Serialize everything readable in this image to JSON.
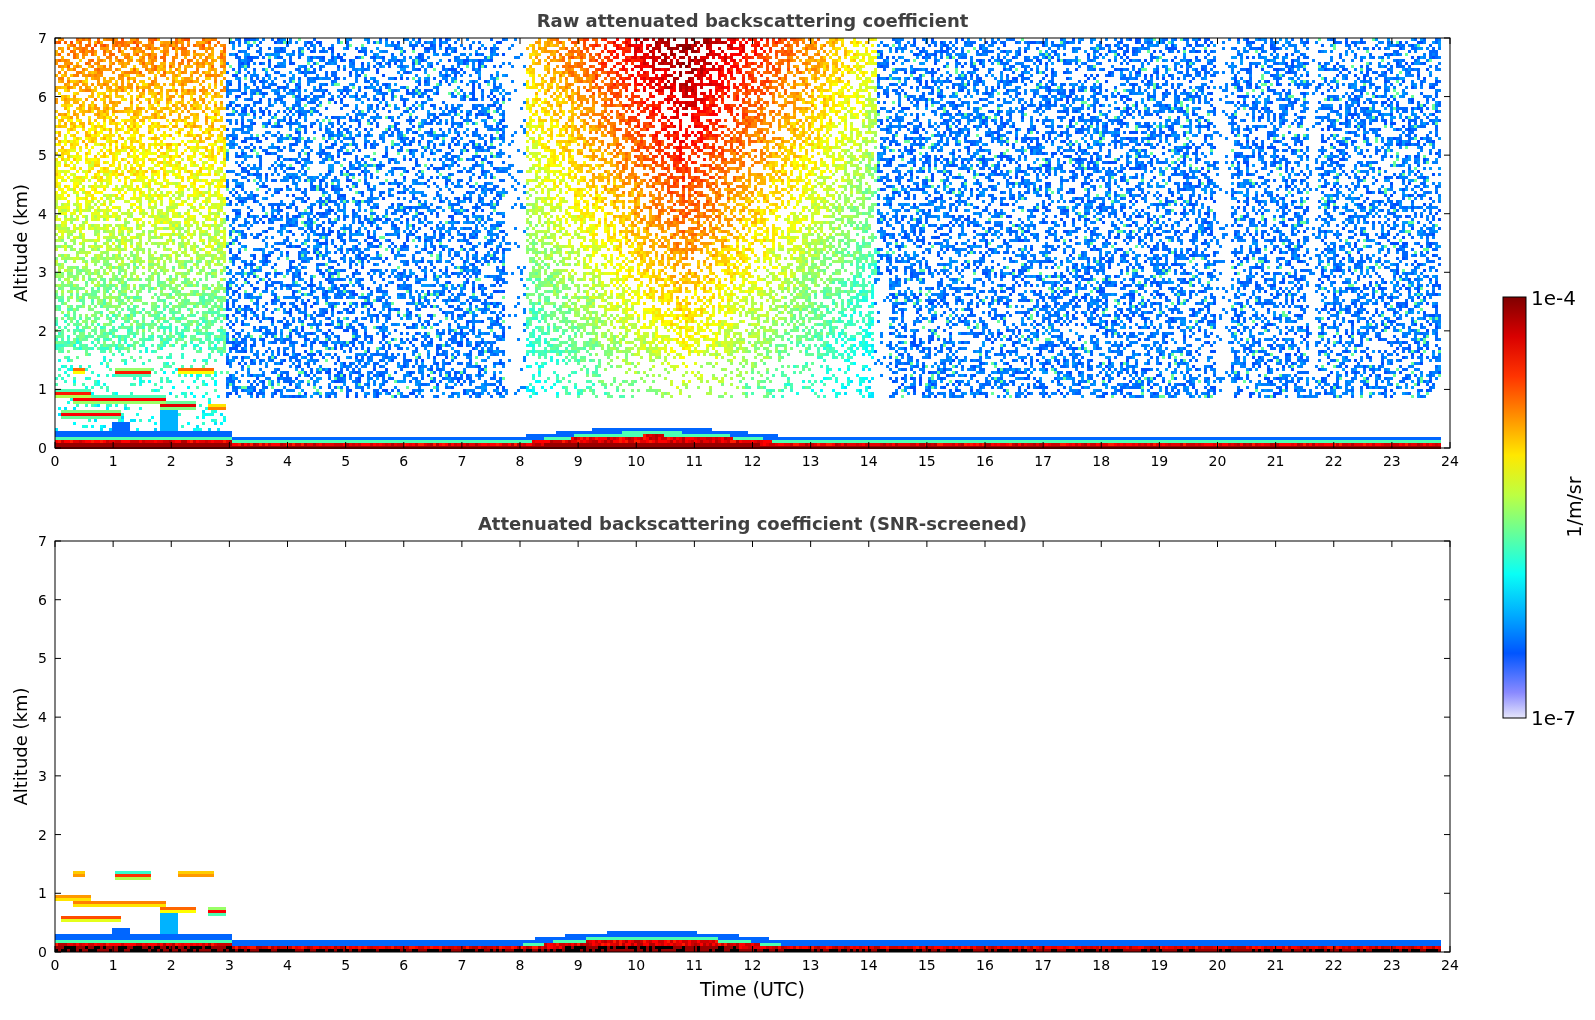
{
  "figure": {
    "panels": [
      {
        "kind": "raw",
        "title": "Raw attenuated backscattering coefficient",
        "ylabel": "Altitude (km)",
        "yticks": [
          "7",
          "6",
          "5",
          "4",
          "3",
          "2",
          "1",
          "0"
        ],
        "xticks": [
          "0",
          "1",
          "2",
          "3",
          "4",
          "5",
          "6",
          "7",
          "8",
          "9",
          "10",
          "11",
          "12",
          "13",
          "14",
          "15",
          "16",
          "17",
          "18",
          "19",
          "20",
          "21",
          "22",
          "23",
          "24"
        ]
      },
      {
        "kind": "screened",
        "title": "Attenuated backscattering coefficient (SNR-screened)",
        "ylabel": "Altitude (km)",
        "xlabel": "Time (UTC)",
        "yticks": [
          "7",
          "6",
          "5",
          "4",
          "3",
          "2",
          "1",
          "0"
        ],
        "xticks": [
          "0",
          "1",
          "2",
          "3",
          "4",
          "5",
          "6",
          "7",
          "8",
          "9",
          "10",
          "11",
          "12",
          "13",
          "14",
          "15",
          "16",
          "17",
          "18",
          "19",
          "20",
          "21",
          "22",
          "23",
          "24"
        ]
      }
    ],
    "colorbar": {
      "label": "1/m/sr",
      "top_label": "1e-4",
      "bottom_label": "1e-7"
    }
  }
}
